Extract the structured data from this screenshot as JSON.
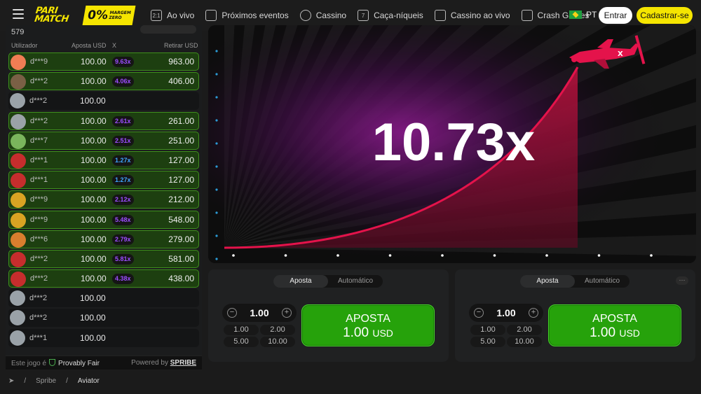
{
  "header": {
    "brand": "PARI MATCH",
    "badge_big": "0%",
    "badge_small": "MARGEM ZERO",
    "nav": [
      {
        "label": "Ao vivo",
        "icon": "live-icon"
      },
      {
        "label": "Próximos eventos",
        "icon": "calendar-icon"
      },
      {
        "label": "Cassino",
        "icon": "casino-chip-icon"
      },
      {
        "label": "Caça-níqueis",
        "icon": "slot-icon"
      },
      {
        "label": "Cassino ao vivo",
        "icon": "cards-icon"
      },
      {
        "label": "Crash Games",
        "icon": "rocket-icon"
      }
    ],
    "language": "PT",
    "login": "Entrar",
    "register": "Cadastrar-se"
  },
  "bets_list": {
    "count": "579",
    "columns": {
      "user": "Utilizador",
      "bet": "Aposta USD",
      "mult": "X",
      "cashout": "Retirar USD"
    },
    "rows": [
      {
        "user": "d***9",
        "bet": "100.00",
        "mult": "9.63x",
        "cashout": "963.00",
        "win": true,
        "color": "#ef7d54",
        "mcolor": "#9b4dff"
      },
      {
        "user": "d***2",
        "bet": "100.00",
        "mult": "4.06x",
        "cashout": "406.00",
        "win": true,
        "color": "#7a6045",
        "mcolor": "#9b4dff"
      },
      {
        "user": "d***2",
        "bet": "100.00",
        "mult": "",
        "cashout": "",
        "win": false,
        "color": "#9aa2a8",
        "mcolor": ""
      },
      {
        "user": "d***2",
        "bet": "100.00",
        "mult": "2.61x",
        "cashout": "261.00",
        "win": true,
        "color": "#9aa2a8",
        "mcolor": "#9b4dff"
      },
      {
        "user": "d***7",
        "bet": "100.00",
        "mult": "2.51x",
        "cashout": "251.00",
        "win": true,
        "color": "#7ab55c",
        "mcolor": "#9b4dff"
      },
      {
        "user": "d***1",
        "bet": "100.00",
        "mult": "1.27x",
        "cashout": "127.00",
        "win": true,
        "color": "#c62d2d",
        "mcolor": "#3ea5ff"
      },
      {
        "user": "d***1",
        "bet": "100.00",
        "mult": "1.27x",
        "cashout": "127.00",
        "win": true,
        "color": "#c62d2d",
        "mcolor": "#3ea5ff"
      },
      {
        "user": "d***9",
        "bet": "100.00",
        "mult": "2.12x",
        "cashout": "212.00",
        "win": true,
        "color": "#d9a323",
        "mcolor": "#9b4dff"
      },
      {
        "user": "d***9",
        "bet": "100.00",
        "mult": "5.48x",
        "cashout": "548.00",
        "win": true,
        "color": "#d9a323",
        "mcolor": "#9b4dff"
      },
      {
        "user": "d***6",
        "bet": "100.00",
        "mult": "2.79x",
        "cashout": "279.00",
        "win": true,
        "color": "#d97e2e",
        "mcolor": "#9b4dff"
      },
      {
        "user": "d***2",
        "bet": "100.00",
        "mult": "5.81x",
        "cashout": "581.00",
        "win": true,
        "color": "#c62d2d",
        "mcolor": "#9b4dff"
      },
      {
        "user": "d***2",
        "bet": "100.00",
        "mult": "4.38x",
        "cashout": "438.00",
        "win": true,
        "color": "#c62d2d",
        "mcolor": "#9b4dff"
      },
      {
        "user": "d***2",
        "bet": "100.00",
        "mult": "",
        "cashout": "",
        "win": false,
        "color": "#9aa2a8",
        "mcolor": ""
      },
      {
        "user": "d***2",
        "bet": "100.00",
        "mult": "",
        "cashout": "",
        "win": false,
        "color": "#9aa2a8",
        "mcolor": ""
      },
      {
        "user": "d***1",
        "bet": "100.00",
        "mult": "",
        "cashout": "",
        "win": false,
        "color": "#9aa2a8",
        "mcolor": ""
      }
    ],
    "provably_prefix": "Este jogo é",
    "provably": "Provably Fair",
    "powered_prefix": "Powered by",
    "powered": "SPRIBE"
  },
  "game": {
    "multiplier": "10.73x",
    "curve_color": "#e4134b",
    "plane_color": "#e4134b"
  },
  "bet_panels": [
    {
      "tab_bet": "Aposta",
      "tab_auto": "Automático",
      "amount": "1.00",
      "quick": [
        "1.00",
        "2.00",
        "5.00",
        "10.00"
      ],
      "button_line1": "APOSTA",
      "button_amount": "1.00",
      "button_currency": "USD",
      "show_more": false
    },
    {
      "tab_bet": "Aposta",
      "tab_auto": "Automático",
      "amount": "1.00",
      "quick": [
        "1.00",
        "2.00",
        "5.00",
        "10.00"
      ],
      "button_line1": "APOSTA",
      "button_amount": "1.00",
      "button_currency": "USD",
      "show_more": true,
      "more": "···"
    }
  ],
  "breadcrumb": [
    "/",
    "Spribe",
    "/",
    "Aviator"
  ]
}
